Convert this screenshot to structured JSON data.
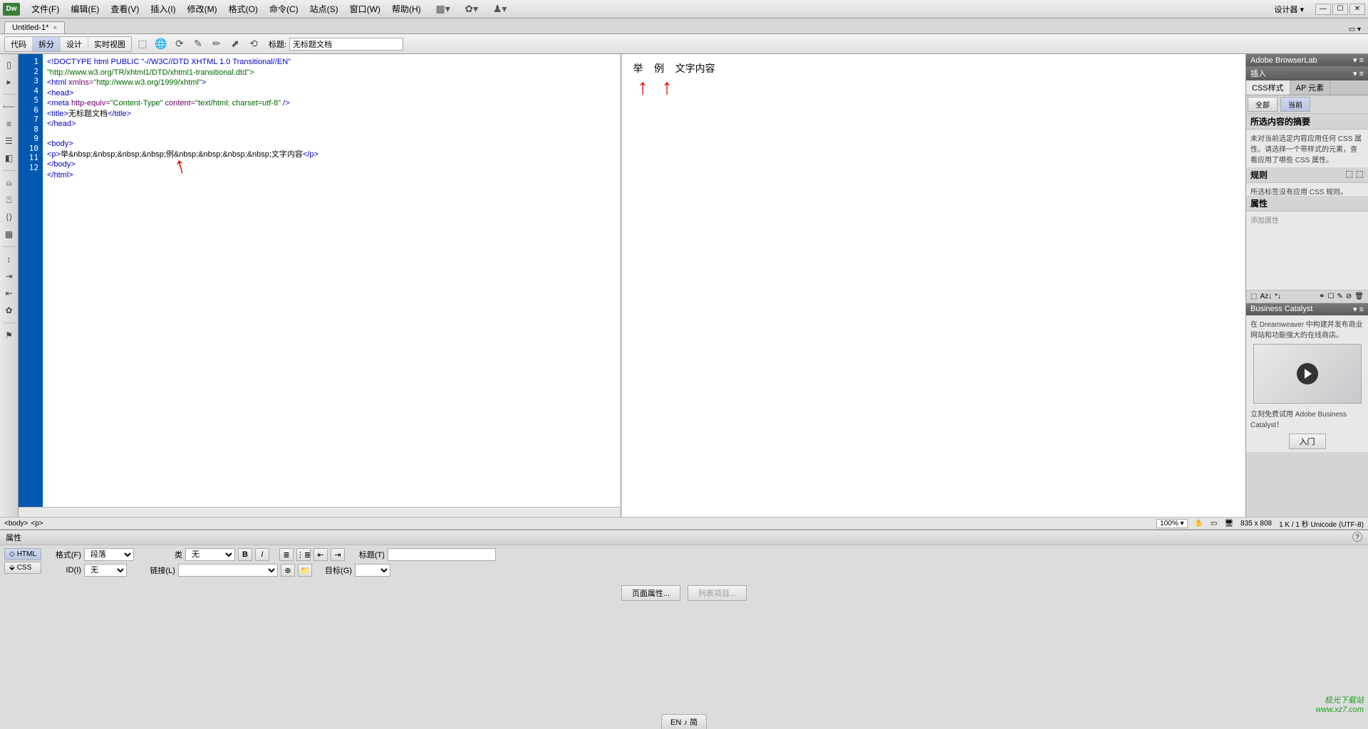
{
  "menubar": {
    "logo": "Dw",
    "items": [
      "文件(F)",
      "编辑(E)",
      "查看(V)",
      "插入(I)",
      "修改(M)",
      "格式(O)",
      "命令(C)",
      "站点(S)",
      "窗口(W)",
      "帮助(H)"
    ],
    "designer": "设计器"
  },
  "docTab": {
    "name": "Untitled-1*",
    "close": "×"
  },
  "viewToolbar": {
    "views": [
      "代码",
      "拆分",
      "设计",
      "实时视图"
    ],
    "titleLabel": "标题:",
    "titleValue": "无标题文档"
  },
  "code": {
    "lines": [
      1,
      2,
      3,
      4,
      5,
      6,
      7,
      8,
      9,
      10,
      11,
      12
    ],
    "l1": "<!DOCTYPE html PUBLIC \"-//W3C//DTD XHTML 1.0 Transitional//EN\"",
    "l2": "\"http://www.w3.org/TR/xhtml1/DTD/xhtml1-transitional.dtd\">",
    "l3a": "<html ",
    "l3b": "xmlns=",
    "l3c": "\"http://www.w3.org/1999/xhtml\"",
    "l3d": ">",
    "l4": "<head>",
    "l5a": "<meta ",
    "l5b": "http-equiv=",
    "l5c": "\"Content-Type\" ",
    "l5d": "content=",
    "l5e": "\"text/html; charset=utf-8\" ",
    "l5f": "/>",
    "l6a": "<title>",
    "l6b": "无标题文档",
    "l6c": "</title>",
    "l7": "</head>",
    "l8": "",
    "l9": "<body>",
    "l10a": "<p>",
    "l10b": "举&nbsp;&nbsp;&nbsp;&nbsp;例&nbsp;&nbsp;&nbsp;&nbsp;文字内容",
    "l10c": "</p>",
    "l11": "</body>",
    "l12": "</html>"
  },
  "preview": {
    "text1": "举",
    "text2": "例",
    "text3": "文字内容"
  },
  "tagSelector": {
    "tags": [
      "<body>",
      "<p>"
    ],
    "zoom": "100%",
    "dims": "835 x 808",
    "size": "1 K / 1 秒 Unicode (UTF-8)"
  },
  "rightPanels": {
    "browserLab": "Adobe BrowserLab",
    "insert": "插入",
    "css": {
      "tabs": [
        "CSS样式",
        "AP 元素"
      ],
      "btns": [
        "全部",
        "当前"
      ],
      "summaryTitle": "所选内容的摘要",
      "summaryText": "未对当前选定内容应用任何 CSS 属性。请选择一个带样式的元素，查看应用了哪些 CSS 属性。",
      "rulesTitle": "规则",
      "rulesText": "所选标签没有应用 CSS 规则。",
      "propsTitle": "属性",
      "addProp": "添加属性"
    },
    "bc": {
      "title": "Business Catalyst",
      "text1": "在 Dreamweaver 中构建并发布商业网站和功能强大的在线商店。",
      "text2": "立刻免费试用 Adobe Business Catalyst！",
      "btn": "入门"
    }
  },
  "props": {
    "title": "属性",
    "modeHtml": "HTML",
    "modeCss": "CSS",
    "format": "格式(F)",
    "formatVal": "段落",
    "cls": "类",
    "clsVal": "无",
    "id": "ID(I)",
    "idVal": "无",
    "link": "链接(L)",
    "linkVal": "",
    "titleLabel": "标题(T)",
    "target": "目标(G)",
    "pageProps": "页面属性...",
    "listItem": "列表项目..."
  },
  "langBar": "EN ♪ 简",
  "watermark": {
    "l1": "极光下载站",
    "l2": "www.xz7.com"
  }
}
